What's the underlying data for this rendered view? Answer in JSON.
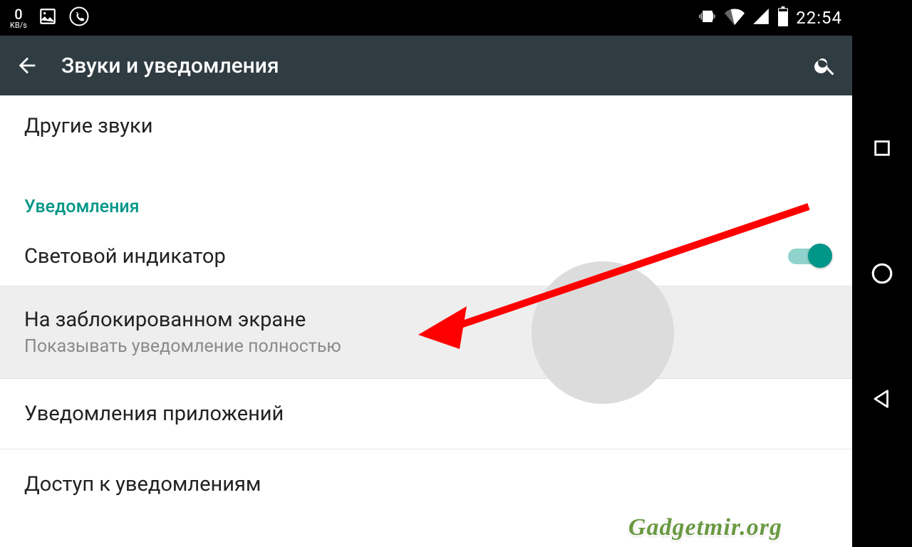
{
  "status": {
    "kbs_value": "0",
    "kbs_unit": "KB/s",
    "clock": "22:54"
  },
  "actionbar": {
    "title": "Звуки и уведомления"
  },
  "list": {
    "other_sounds": "Другие звуки",
    "section_notifications": "Уведомления",
    "light_indicator": "Световой индикатор",
    "lock_screen_title": "На заблокированном экране",
    "lock_screen_subtitle": "Показывать уведомление полностью",
    "app_notifications": "Уведомления приложений",
    "notification_access": "Доступ к уведомлениям"
  },
  "watermark": "Gadgetmir.org"
}
